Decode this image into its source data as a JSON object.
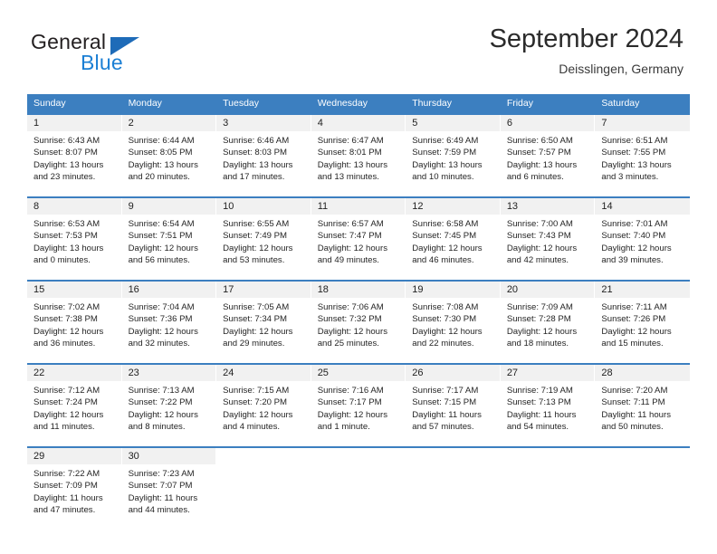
{
  "logo": {
    "word_top": "General",
    "word_bottom": "Blue",
    "triangle_color": "#1e6bb8",
    "blue_color": "#1b7fd4"
  },
  "header": {
    "title": "September 2024",
    "subtitle": "Deisslingen, Germany"
  },
  "theme": {
    "header_blue": "#3c7fc0",
    "daynum_band": "#f1f1f1",
    "text": "#252525"
  },
  "weekdays": [
    "Sunday",
    "Monday",
    "Tuesday",
    "Wednesday",
    "Thursday",
    "Friday",
    "Saturday"
  ],
  "weeks": [
    [
      {
        "day": "1",
        "lines": [
          "Sunrise: 6:43 AM",
          "Sunset: 8:07 PM",
          "Daylight: 13 hours",
          "and 23 minutes."
        ]
      },
      {
        "day": "2",
        "lines": [
          "Sunrise: 6:44 AM",
          "Sunset: 8:05 PM",
          "Daylight: 13 hours",
          "and 20 minutes."
        ]
      },
      {
        "day": "3",
        "lines": [
          "Sunrise: 6:46 AM",
          "Sunset: 8:03 PM",
          "Daylight: 13 hours",
          "and 17 minutes."
        ]
      },
      {
        "day": "4",
        "lines": [
          "Sunrise: 6:47 AM",
          "Sunset: 8:01 PM",
          "Daylight: 13 hours",
          "and 13 minutes."
        ]
      },
      {
        "day": "5",
        "lines": [
          "Sunrise: 6:49 AM",
          "Sunset: 7:59 PM",
          "Daylight: 13 hours",
          "and 10 minutes."
        ]
      },
      {
        "day": "6",
        "lines": [
          "Sunrise: 6:50 AM",
          "Sunset: 7:57 PM",
          "Daylight: 13 hours",
          "and 6 minutes."
        ]
      },
      {
        "day": "7",
        "lines": [
          "Sunrise: 6:51 AM",
          "Sunset: 7:55 PM",
          "Daylight: 13 hours",
          "and 3 minutes."
        ]
      }
    ],
    [
      {
        "day": "8",
        "lines": [
          "Sunrise: 6:53 AM",
          "Sunset: 7:53 PM",
          "Daylight: 13 hours",
          "and 0 minutes."
        ]
      },
      {
        "day": "9",
        "lines": [
          "Sunrise: 6:54 AM",
          "Sunset: 7:51 PM",
          "Daylight: 12 hours",
          "and 56 minutes."
        ]
      },
      {
        "day": "10",
        "lines": [
          "Sunrise: 6:55 AM",
          "Sunset: 7:49 PM",
          "Daylight: 12 hours",
          "and 53 minutes."
        ]
      },
      {
        "day": "11",
        "lines": [
          "Sunrise: 6:57 AM",
          "Sunset: 7:47 PM",
          "Daylight: 12 hours",
          "and 49 minutes."
        ]
      },
      {
        "day": "12",
        "lines": [
          "Sunrise: 6:58 AM",
          "Sunset: 7:45 PM",
          "Daylight: 12 hours",
          "and 46 minutes."
        ]
      },
      {
        "day": "13",
        "lines": [
          "Sunrise: 7:00 AM",
          "Sunset: 7:43 PM",
          "Daylight: 12 hours",
          "and 42 minutes."
        ]
      },
      {
        "day": "14",
        "lines": [
          "Sunrise: 7:01 AM",
          "Sunset: 7:40 PM",
          "Daylight: 12 hours",
          "and 39 minutes."
        ]
      }
    ],
    [
      {
        "day": "15",
        "lines": [
          "Sunrise: 7:02 AM",
          "Sunset: 7:38 PM",
          "Daylight: 12 hours",
          "and 36 minutes."
        ]
      },
      {
        "day": "16",
        "lines": [
          "Sunrise: 7:04 AM",
          "Sunset: 7:36 PM",
          "Daylight: 12 hours",
          "and 32 minutes."
        ]
      },
      {
        "day": "17",
        "lines": [
          "Sunrise: 7:05 AM",
          "Sunset: 7:34 PM",
          "Daylight: 12 hours",
          "and 29 minutes."
        ]
      },
      {
        "day": "18",
        "lines": [
          "Sunrise: 7:06 AM",
          "Sunset: 7:32 PM",
          "Daylight: 12 hours",
          "and 25 minutes."
        ]
      },
      {
        "day": "19",
        "lines": [
          "Sunrise: 7:08 AM",
          "Sunset: 7:30 PM",
          "Daylight: 12 hours",
          "and 22 minutes."
        ]
      },
      {
        "day": "20",
        "lines": [
          "Sunrise: 7:09 AM",
          "Sunset: 7:28 PM",
          "Daylight: 12 hours",
          "and 18 minutes."
        ]
      },
      {
        "day": "21",
        "lines": [
          "Sunrise: 7:11 AM",
          "Sunset: 7:26 PM",
          "Daylight: 12 hours",
          "and 15 minutes."
        ]
      }
    ],
    [
      {
        "day": "22",
        "lines": [
          "Sunrise: 7:12 AM",
          "Sunset: 7:24 PM",
          "Daylight: 12 hours",
          "and 11 minutes."
        ]
      },
      {
        "day": "23",
        "lines": [
          "Sunrise: 7:13 AM",
          "Sunset: 7:22 PM",
          "Daylight: 12 hours",
          "and 8 minutes."
        ]
      },
      {
        "day": "24",
        "lines": [
          "Sunrise: 7:15 AM",
          "Sunset: 7:20 PM",
          "Daylight: 12 hours",
          "and 4 minutes."
        ]
      },
      {
        "day": "25",
        "lines": [
          "Sunrise: 7:16 AM",
          "Sunset: 7:17 PM",
          "Daylight: 12 hours",
          "and 1 minute."
        ]
      },
      {
        "day": "26",
        "lines": [
          "Sunrise: 7:17 AM",
          "Sunset: 7:15 PM",
          "Daylight: 11 hours",
          "and 57 minutes."
        ]
      },
      {
        "day": "27",
        "lines": [
          "Sunrise: 7:19 AM",
          "Sunset: 7:13 PM",
          "Daylight: 11 hours",
          "and 54 minutes."
        ]
      },
      {
        "day": "28",
        "lines": [
          "Sunrise: 7:20 AM",
          "Sunset: 7:11 PM",
          "Daylight: 11 hours",
          "and 50 minutes."
        ]
      }
    ],
    [
      {
        "day": "29",
        "lines": [
          "Sunrise: 7:22 AM",
          "Sunset: 7:09 PM",
          "Daylight: 11 hours",
          "and 47 minutes."
        ]
      },
      {
        "day": "30",
        "lines": [
          "Sunrise: 7:23 AM",
          "Sunset: 7:07 PM",
          "Daylight: 11 hours",
          "and 44 minutes."
        ]
      },
      {
        "day": "",
        "lines": []
      },
      {
        "day": "",
        "lines": []
      },
      {
        "day": "",
        "lines": []
      },
      {
        "day": "",
        "lines": []
      },
      {
        "day": "",
        "lines": []
      }
    ]
  ]
}
